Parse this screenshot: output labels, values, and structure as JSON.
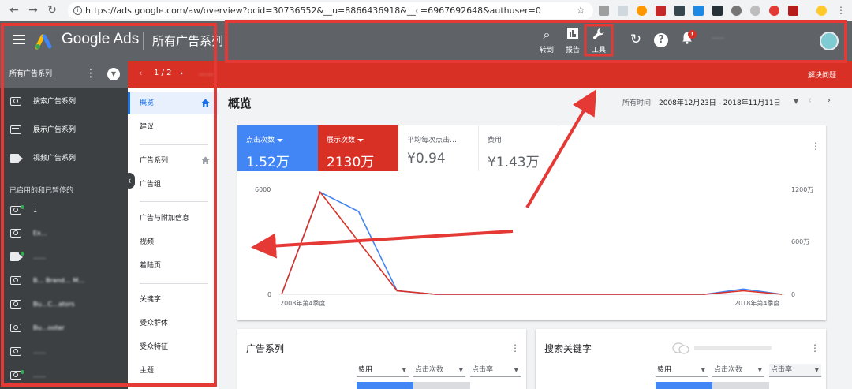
{
  "browser": {
    "url": "https://ads.google.com/aw/overview?ocid=30736552&__u=8866436918&__c=6967692648&authuser=0"
  },
  "topbar": {
    "brand": "Google Ads",
    "page_title": "所有广告系列",
    "goto_label": "转到",
    "reports_label": "报告",
    "tools_label": "工具",
    "account_text": "……"
  },
  "left_panel": {
    "header": "所有广告系列",
    "types": [
      {
        "label": "搜索广告系列",
        "icon": "search-campaign-icon"
      },
      {
        "label": "展示广告系列",
        "icon": "display-campaign-icon"
      },
      {
        "label": "视频广告系列",
        "icon": "video-campaign-icon"
      }
    ],
    "section_label": "已启用的和已暂停的",
    "campaigns": [
      {
        "name": "1"
      },
      {
        "name": "Ex…"
      },
      {
        "name": "……"
      },
      {
        "name": "B… Brand… M…"
      },
      {
        "name": "Bu…C…ators"
      },
      {
        "name": "Bu…ooter"
      },
      {
        "name": "……"
      },
      {
        "name": "……"
      }
    ]
  },
  "notice_bar": {
    "pager": "1 / 2",
    "message": "……",
    "action": "解决问题"
  },
  "page_nav": {
    "items": [
      "概览",
      "建议",
      "广告系列",
      "广告组",
      "广告与附加信息",
      "视频",
      "着陆页",
      "关键字",
      "受众群体",
      "受众特征",
      "主题"
    ]
  },
  "overview": {
    "title": "概览",
    "date_label": "所有时间",
    "date_range": "2008年12月23日 - 2018年11月11日"
  },
  "metrics": {
    "clicks": {
      "label": "点击次数",
      "value": "1.52万"
    },
    "impressions": {
      "label": "展示次数",
      "value": "2130万"
    },
    "avg_cpc": {
      "label": "平均每次点击…",
      "value": "¥0.94"
    },
    "cost": {
      "label": "费用",
      "value": "¥1.43万"
    }
  },
  "chart_data": {
    "type": "line",
    "x_labels": [
      "2008年第4季度",
      "2018年第4季度"
    ],
    "left_axis": {
      "ticks": [
        "0",
        "6000"
      ],
      "ylim": [
        0,
        6000
      ]
    },
    "right_axis": {
      "ticks": [
        "0",
        "600万",
        "1200万"
      ],
      "ylim": [
        0,
        12000000
      ]
    },
    "series": [
      {
        "name": "点击次数",
        "color": "#4285f4",
        "values": [
          0,
          5800,
          4700,
          200,
          0,
          0,
          0,
          0,
          0,
          0,
          0,
          0,
          300,
          0
        ]
      },
      {
        "name": "展示次数",
        "color": "#d93025",
        "values": [
          0,
          11600000,
          6000000,
          400000,
          0,
          0,
          0,
          0,
          0,
          0,
          0,
          0,
          400000,
          0
        ]
      }
    ]
  },
  "campaign_card": {
    "title": "广告系列",
    "sel1": "费用",
    "sel2": "点击次数",
    "sel3": "点击率"
  },
  "keyword_card": {
    "title": "搜索关键字",
    "sel1": "费用",
    "sel2": "点击次数",
    "sel3": "点击率"
  },
  "colors": {
    "accent_blue": "#4285f4",
    "accent_red": "#d93025",
    "header_gray": "#5f6368",
    "annotation_red": "#e53935"
  }
}
